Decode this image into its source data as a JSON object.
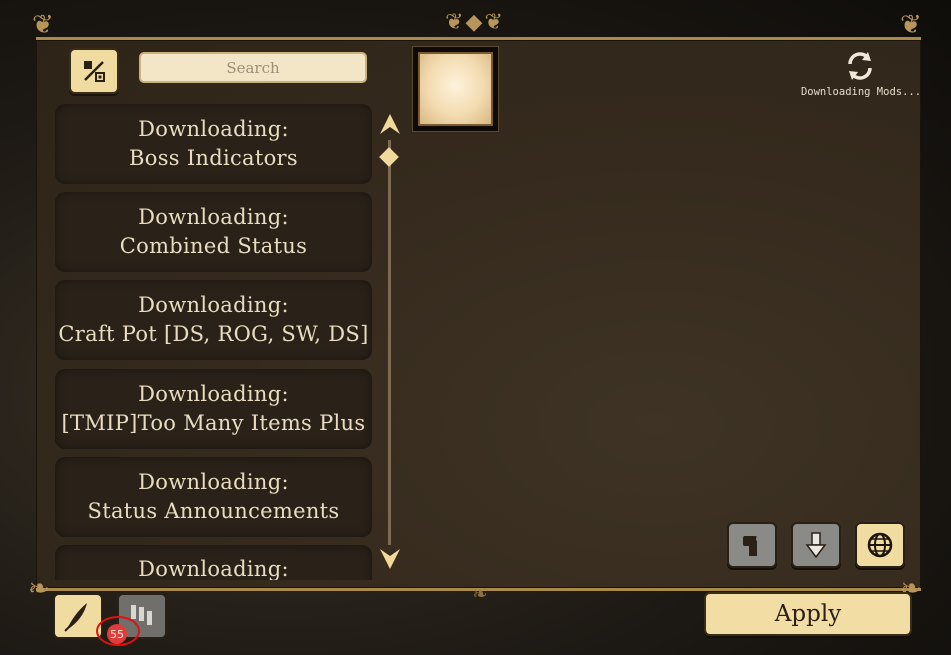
{
  "search": {
    "placeholder": "Search"
  },
  "mods": [
    {
      "line1": "Downloading:",
      "line2": "Boss Indicators"
    },
    {
      "line1": "Downloading:",
      "line2": "Combined Status"
    },
    {
      "line1": "Downloading:",
      "line2": "Craft Pot [DS, ROG, SW, DS]"
    },
    {
      "line1": "Downloading:",
      "line2": "[TMIP]Too Many Items Plus"
    },
    {
      "line1": "Downloading:",
      "line2": "Status Announcements"
    },
    {
      "line1": "Downloading:",
      "line2": ""
    }
  ],
  "status": {
    "downloading_text": "Downloading Mods..."
  },
  "toolbar": {
    "apply_label": "Apply"
  },
  "notification": {
    "count": "55"
  },
  "icons": {
    "filter": "filter-icon",
    "refresh": "refresh-icon",
    "scroll_up": "scroll-up-arrow-icon",
    "scroll_down": "scroll-down-arrow-icon",
    "workshop": "wrench-icon",
    "download": "download-arrow-icon",
    "globe": "globe-icon",
    "feather": "feather-icon",
    "players": "players-icon"
  },
  "colors": {
    "accent": "#f0dca0",
    "panel": "#352a1d",
    "text": "#e9dcc0",
    "badge": "#e23b3b"
  }
}
